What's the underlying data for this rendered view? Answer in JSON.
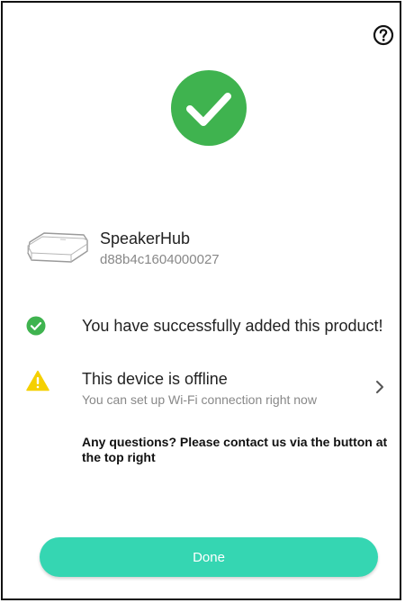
{
  "colors": {
    "success_green": "#3fb34f",
    "accent_teal": "#35d6b2",
    "warning_yellow": "#f5d000",
    "text_primary": "#222222",
    "text_secondary": "#888888"
  },
  "header": {
    "help_icon": "question-circle-icon"
  },
  "hero": {
    "icon": "large-check-circle-icon"
  },
  "device": {
    "name": "SpeakerHub",
    "id": "d88b4c1604000027"
  },
  "status": {
    "icon": "check-circle-icon",
    "message": "You have successfully added this product!"
  },
  "offline": {
    "icon": "warning-icon",
    "title": "This device is offline",
    "subtitle": "You can set up Wi-Fi connection right now",
    "chevron": "chevron-right-icon"
  },
  "help_text": "Any questions? Please contact us via the button at the top right",
  "footer": {
    "done_label": "Done"
  }
}
